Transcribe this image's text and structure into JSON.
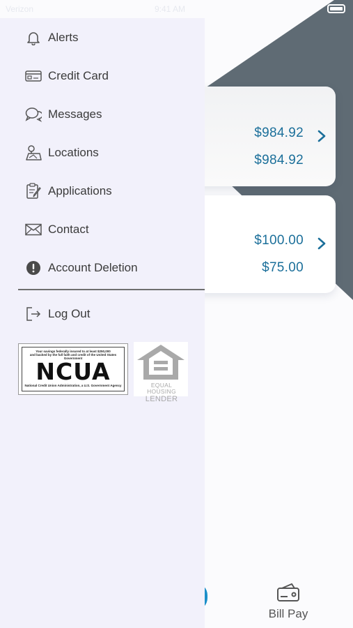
{
  "status_bar": {
    "carrier": "Verizon",
    "time": "9:41 AM"
  },
  "drawer": {
    "items": [
      {
        "label": "Alerts",
        "icon": "bell-icon"
      },
      {
        "label": "Credit Card",
        "icon": "credit-card-icon"
      },
      {
        "label": "Messages",
        "icon": "chat-bubbles-icon"
      },
      {
        "label": "Locations",
        "icon": "map-icon"
      },
      {
        "label": "Applications",
        "icon": "document-pen-icon"
      },
      {
        "label": "Contact",
        "icon": "envelope-icon"
      },
      {
        "label": "Account Deletion",
        "icon": "exclamation-circle-icon"
      }
    ],
    "logout": {
      "label": "Log Out",
      "icon": "logout-icon"
    },
    "ncua": {
      "line1": "Your savings federally insured to at least $250,000",
      "line2": "and backed by the full faith and credit of the United States Government",
      "title": "NCUA",
      "line3": "National Credit Union Administration, a U.S. Government Agency"
    },
    "equal_housing": {
      "line1": "EQUAL HOUSING",
      "line2": "LENDER"
    }
  },
  "accounts": [
    {
      "amount_1": "$984.92",
      "amount_2": "$984.92"
    },
    {
      "amount_1": "$100.00",
      "amount_2": "$75.00"
    }
  ],
  "bottom_nav": {
    "bill_pay_label": "Bill Pay"
  },
  "colors": {
    "amount": "#1b6f9a",
    "drawer_bg": "#f2f1fb",
    "header_dark": "#5f6b74"
  }
}
